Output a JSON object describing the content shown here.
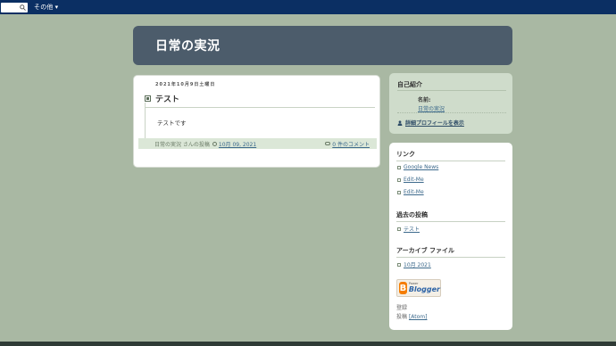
{
  "navbar": {
    "more_label": "その他",
    "more_arrow": "▾"
  },
  "blog": {
    "title": "日常の実況"
  },
  "post": {
    "date": "2021年10月9日土曜日",
    "title": "テスト",
    "body": "テストです",
    "author_line": "日常の実況 さんの投稿",
    "timestamp": "10月 09, 2021",
    "comments": "0 件のコメント"
  },
  "profile": {
    "heading": "自己紹介",
    "name_label": "名前:",
    "name": "日常の実況",
    "view_full": "詳細プロフィールを表示"
  },
  "links": {
    "heading": "リンク",
    "items": [
      "Google News",
      "Edit-Me",
      "Edit-Me"
    ]
  },
  "previous_posts": {
    "heading": "過去の投稿",
    "items": [
      "テスト"
    ]
  },
  "archives": {
    "heading": "アーカイブ ファイル",
    "items": [
      "10月 2021"
    ]
  },
  "badge": {
    "small": "Power",
    "big": "Blogger",
    "letter": "B"
  },
  "subscribe": {
    "label": "登録",
    "posts_label": "投稿",
    "atom": "[Atom]"
  },
  "colors": {
    "background": "#a9b8a3",
    "navbar": "#0b2f63",
    "header": "#4c5c6b",
    "link": "#3d6a8c"
  }
}
